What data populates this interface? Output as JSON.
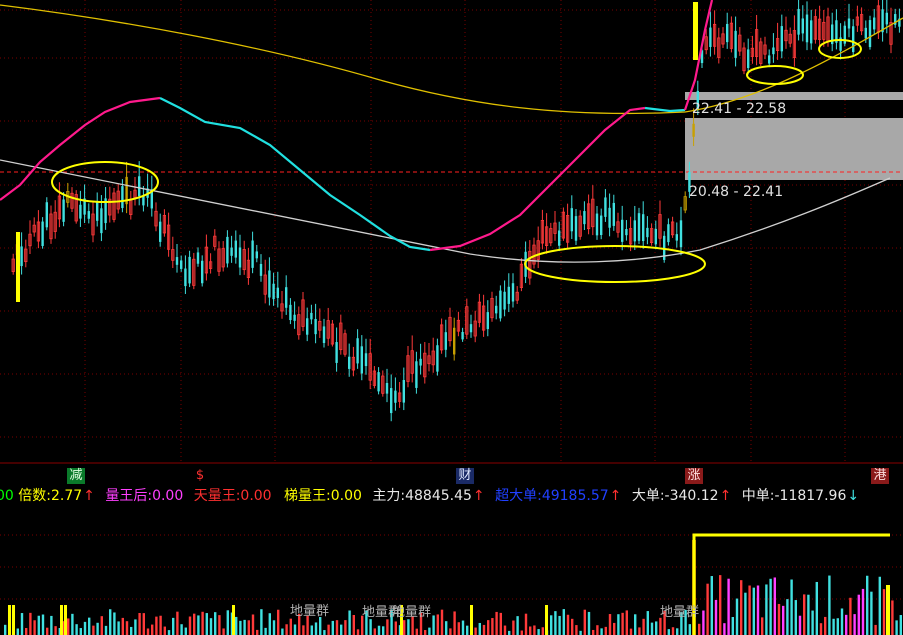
{
  "chart_data": {
    "type": "candlestick",
    "indicator_bar": {
      "items": [
        {
          "label": "00",
          "value": "",
          "label_color": "#00ff00",
          "value_color": "#00ff00",
          "arrow": ""
        },
        {
          "label": "倍数: ",
          "value": "2.77",
          "label_color": "#ffff00",
          "value_color": "#ffff00",
          "arrow": "up"
        },
        {
          "label": "量王后: ",
          "value": "0.00",
          "label_color": "#ff40ff",
          "value_color": "#ff40ff",
          "arrow": ""
        },
        {
          "label": "天量王: ",
          "value": "0.00",
          "label_color": "#ff3030",
          "value_color": "#ff3030",
          "arrow": ""
        },
        {
          "label": "梯量王: ",
          "value": "0.00",
          "label_color": "#ffff00",
          "value_color": "#ffff00",
          "arrow": ""
        },
        {
          "label": "主力: ",
          "value": "48845.45",
          "label_color": "#e8e8e8",
          "value_color": "#e8e8e8",
          "arrow": "up"
        },
        {
          "label": "超大单: ",
          "value": "49185.57",
          "label_color": "#2040ff",
          "value_color": "#2040ff",
          "arrow": "up"
        },
        {
          "label": "大单: ",
          "value": "-340.12",
          "label_color": "#e8e8e8",
          "value_color": "#e8e8e8",
          "arrow": "up"
        },
        {
          "label": "中单: ",
          "value": "-11817.96",
          "label_color": "#e8e8e8",
          "value_color": "#e8e8e8",
          "arrow": "down"
        }
      ]
    },
    "event_flags": [
      {
        "text": "减",
        "bg": "#0a7a2a",
        "color": "#e0ffe0"
      },
      {
        "text": "$",
        "bg": "#000000",
        "color": "#ff3030"
      },
      {
        "text": "财",
        "bg": "#1a2a66",
        "color": "#e0e8ff"
      },
      {
        "text": "涨",
        "bg": "#8a1a1a",
        "color": "#ffe0e0"
      },
      {
        "text": "港",
        "bg": "#8a1a1a",
        "color": "#ffe0e0"
      }
    ],
    "price_zones": [
      {
        "label": "22.41 - 22.58"
      },
      {
        "label": "20.48 - 22.41"
      }
    ],
    "volume_labels": [
      "地量群",
      "地量群",
      "地量群",
      "地量群"
    ],
    "colors": {
      "up": "#ff3a3a",
      "down": "#40e0e0",
      "special": "#c8a000",
      "highlight": "#ffff00",
      "ma_magenta": "#ff1a8c",
      "ma_cyan": "#20e0e0",
      "ma_yellow": "#e0c000",
      "ma_white": "#d0d0d0",
      "zone": "#a8a8a8",
      "resistance": "#ff2020"
    }
  }
}
